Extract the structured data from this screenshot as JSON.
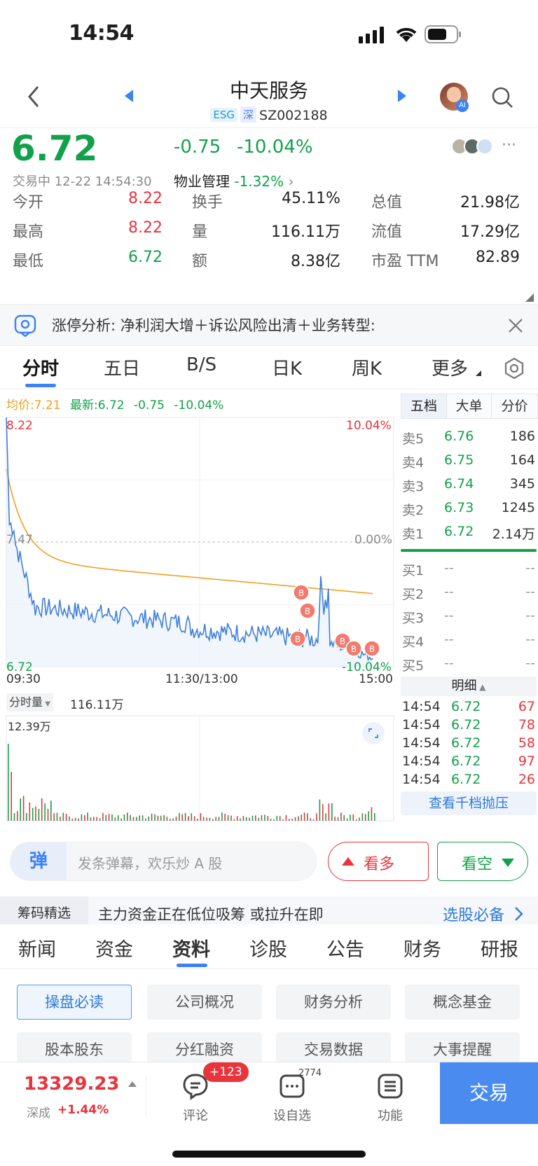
{
  "status_bar": {
    "time": "14:54"
  },
  "nav": {
    "title": "中天服务",
    "tag_esg": "ESG",
    "tag_market": "深",
    "code": "SZ002188",
    "avatar_badge": "AI"
  },
  "quote": {
    "price": "6.72",
    "change": "-0.75",
    "change_pct": "-10.04%",
    "trade_status": "交易中 12-22 14:54:30",
    "sector_name": "物业管理",
    "sector_pct": "-1.32%",
    "more_label": "···",
    "stats": [
      {
        "label": "今开",
        "value": "8.22",
        "color": "red"
      },
      {
        "label": "换手",
        "value": "45.11%",
        "color": "dark"
      },
      {
        "label": "总值",
        "value": "21.98亿",
        "color": "dark"
      },
      {
        "label": "最高",
        "value": "8.22",
        "color": "red"
      },
      {
        "label": "量",
        "value": "116.11万",
        "color": "dark"
      },
      {
        "label": "流值",
        "value": "17.29亿",
        "color": "dark"
      },
      {
        "label": "最低",
        "value": "6.72",
        "color": "green"
      },
      {
        "label": "额",
        "value": "8.38亿",
        "color": "dark"
      },
      {
        "label": "市盈 TTM",
        "value": "82.89",
        "color": "dark"
      }
    ]
  },
  "banner": {
    "text": "涨停分析: 净利润大增＋诉讼风险出清＋业务转型:"
  },
  "tabs": [
    "分时",
    "五日",
    "B/S",
    "日K",
    "周K",
    "更多"
  ],
  "chart": {
    "legend_avg": "均价:7.21",
    "legend_latest": "最新:6.72",
    "legend_change": "-0.75",
    "legend_pct": "-10.04%",
    "y_high": "8.22",
    "y_mid": "7.47",
    "y_low": "6.72",
    "pct_high": "10.04%",
    "pct_mid": "0.00%",
    "pct_low": "-10.04%",
    "x_start": "09:30",
    "x_mid": "11:30/13:00",
    "x_end": "15:00",
    "vol_selector": "分时量",
    "vol_total": "116.11万",
    "vol_max": "12.39万",
    "marker_label": "B"
  },
  "orderbook": {
    "tabs": [
      "五档",
      "大单",
      "分价"
    ],
    "asks": [
      {
        "label": "卖5",
        "price": "6.76",
        "qty": "186"
      },
      {
        "label": "卖4",
        "price": "6.75",
        "qty": "164"
      },
      {
        "label": "卖3",
        "price": "6.74",
        "qty": "345"
      },
      {
        "label": "卖2",
        "price": "6.73",
        "qty": "1245"
      },
      {
        "label": "卖1",
        "price": "6.72",
        "qty": "2.14万"
      }
    ],
    "bids": [
      {
        "label": "买1",
        "price": "--",
        "qty": "--"
      },
      {
        "label": "买2",
        "price": "--",
        "qty": "--"
      },
      {
        "label": "买3",
        "price": "--",
        "qty": "--"
      },
      {
        "label": "买4",
        "price": "--",
        "qty": "--"
      },
      {
        "label": "买5",
        "price": "--",
        "qty": "--"
      }
    ],
    "detail_label": "明细",
    "trades": [
      {
        "time": "14:54",
        "price": "6.72",
        "qty": "67"
      },
      {
        "time": "14:54",
        "price": "6.72",
        "qty": "78"
      },
      {
        "time": "14:54",
        "price": "6.72",
        "qty": "58"
      },
      {
        "time": "14:54",
        "price": "6.72",
        "qty": "97"
      },
      {
        "time": "14:54",
        "price": "6.72",
        "qty": "26"
      }
    ],
    "depth_button": "查看千档抛压"
  },
  "danmu": {
    "icon_char": "弹",
    "placeholder": "发条弹幕，欢乐炒 A 股",
    "bull": "看多",
    "bear": "看空"
  },
  "chips": {
    "tag": "筹码精选",
    "text": "主力资金正在低位吸筹 或拉升在即",
    "link": "选股必备"
  },
  "subtabs": [
    "新闻",
    "资金",
    "资料",
    "诊股",
    "公告",
    "财务",
    "研报"
  ],
  "grid_buttons": [
    "操盘必读",
    "公司概况",
    "财务分析",
    "概念基金",
    "股本股东",
    "分红融资",
    "交易数据",
    "大事提醒"
  ],
  "bottom": {
    "index_value": "13329.23",
    "index_name": "深成",
    "index_pct": "+1.44%",
    "comment_label": "评论",
    "comment_badge": "+123",
    "watch_label": "设自选",
    "watch_count": "2774",
    "func_label": "功能",
    "trade_label": "交易"
  },
  "colors": {
    "up": "#e8343c",
    "down": "#12a14a",
    "accent": "#3b82f6",
    "avg_line": "#f0a020",
    "price_line": "#3f7fd9"
  }
}
